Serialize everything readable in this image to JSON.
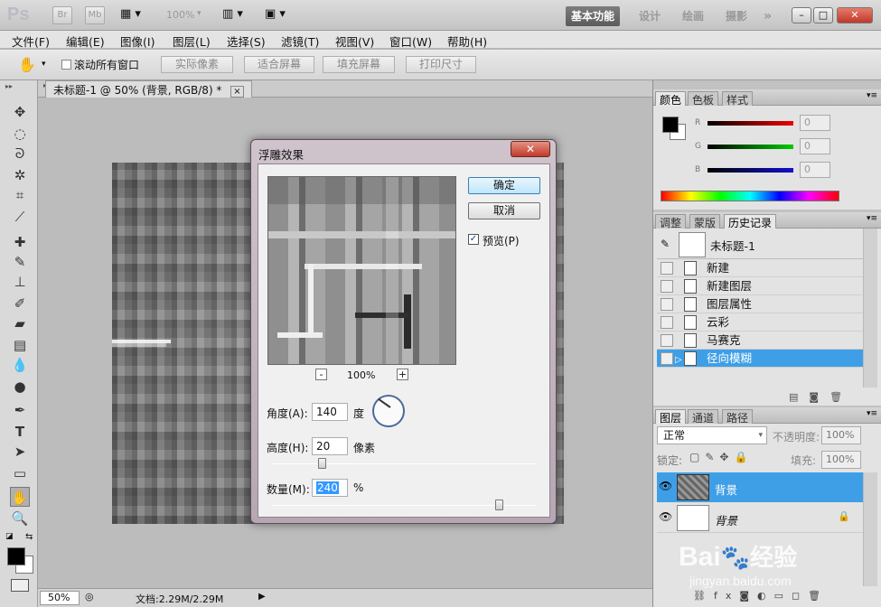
{
  "app": {
    "logo": "Ps",
    "bridge_btn": "Br",
    "minibridge_btn": "Mb",
    "zoom_display": "100%",
    "workspaces": [
      "基本功能",
      "设计",
      "绘画",
      "摄影"
    ],
    "more_workspaces": "»"
  },
  "menu": [
    "文件(F)",
    "编辑(E)",
    "图像(I)",
    "图层(L)",
    "选择(S)",
    "滤镜(T)",
    "视图(V)",
    "窗口(W)",
    "帮助(H)"
  ],
  "options": {
    "scroll_all_label": "滚动所有窗口",
    "buttons": [
      "实际像素",
      "适合屏幕",
      "填充屏幕",
      "打印尺寸"
    ]
  },
  "document": {
    "tab_title": "未标题-1 @ 50% (背景, RGB/8) *",
    "tab_close": "×"
  },
  "status": {
    "zoom": "50%",
    "doc_info": "文档:2.29M/2.29M"
  },
  "color_panel": {
    "tabs": [
      "颜色",
      "色板",
      "样式"
    ],
    "channels": [
      {
        "label": "R",
        "value": "0",
        "color": "#cc1111"
      },
      {
        "label": "G",
        "value": "0",
        "color": "#11aa22"
      },
      {
        "label": "B",
        "value": "0",
        "color": "#1122cc"
      }
    ]
  },
  "history_panel": {
    "tabs": [
      "调整",
      "蒙版",
      "历史记录"
    ],
    "snapshot": "未标题-1",
    "items": [
      "新建",
      "新建图层",
      "图层属性",
      "云彩",
      "马赛克",
      "径向模糊"
    ],
    "selected_index": 5
  },
  "layers_panel": {
    "tabs": [
      "图层",
      "通道",
      "路径"
    ],
    "blend_mode": "正常",
    "opacity_label": "不透明度:",
    "opacity_value": "100%",
    "lock_label": "锁定:",
    "fill_label": "填充:",
    "fill_value": "100%",
    "layers": [
      {
        "name": "背景",
        "selected": true
      },
      {
        "name": "背景",
        "selected": false,
        "locked": true
      }
    ]
  },
  "dialog": {
    "title": "浮雕效果",
    "ok": "确定",
    "cancel": "取消",
    "preview_label": "预览(P)",
    "preview_checked": true,
    "zoom_out": "-",
    "zoom_in": "+",
    "zoom_value": "100%",
    "angle_label": "角度(A):",
    "angle_value": "140",
    "angle_unit": "度",
    "height_label": "高度(H):",
    "height_value": "20",
    "height_unit": "像素",
    "amount_label": "数量(M):",
    "amount_value": "240",
    "amount_unit": "%"
  },
  "watermark": {
    "brand": "Bai",
    "brand_cn": "经验",
    "url": "jingyan.baidu.com"
  }
}
